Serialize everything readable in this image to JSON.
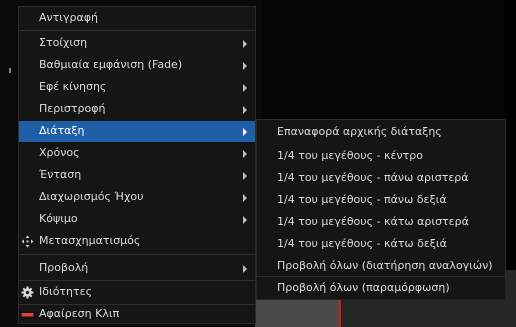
{
  "context_menu": {
    "items": [
      {
        "label": "Αντιγραφή"
      },
      {
        "label": "Στοίχιση"
      },
      {
        "label": "Βαθμιαία εμφάνιση (Fade)"
      },
      {
        "label": "Εφέ κίνησης"
      },
      {
        "label": "Περιστροφή"
      },
      {
        "label": "Διάταξη"
      },
      {
        "label": "Χρόνος"
      },
      {
        "label": "Ένταση"
      },
      {
        "label": "Διαχωρισμός Ήχου"
      },
      {
        "label": "Κόψιμο"
      },
      {
        "label": "Μετασχηματισμός"
      },
      {
        "label": "Προβολή"
      },
      {
        "label": "Ιδιότητες"
      },
      {
        "label": "Αφαίρεση Κλιπ"
      }
    ]
  },
  "submenu": {
    "items": [
      {
        "label": "Επαναφορά αρχικής διάταξης"
      },
      {
        "label": "1/4 του μεγέθους - κέντρο"
      },
      {
        "label": "1/4 του μεγέθους - πάνω αριστερά"
      },
      {
        "label": "1/4 του μεγέθους - πάνω δεξιά"
      },
      {
        "label": "1/4 του μεγέθους - κάτω αριστερά"
      },
      {
        "label": "1/4 του μεγέθους - κάτω δεξιά"
      },
      {
        "label": "Προβολή όλων (διατήρηση αναλογιών)"
      },
      {
        "label": "Προβολή όλων (παραμόρφωση)"
      }
    ]
  },
  "colors": {
    "menu_bg": "#151515",
    "highlight": "#1f5fa8",
    "remove_icon": "#e0413a",
    "timeline_marker": "#d01e1e"
  },
  "icons": {
    "transform": "move-arrows-icon",
    "properties": "gear-icon",
    "remove": "minus-bar-icon"
  }
}
